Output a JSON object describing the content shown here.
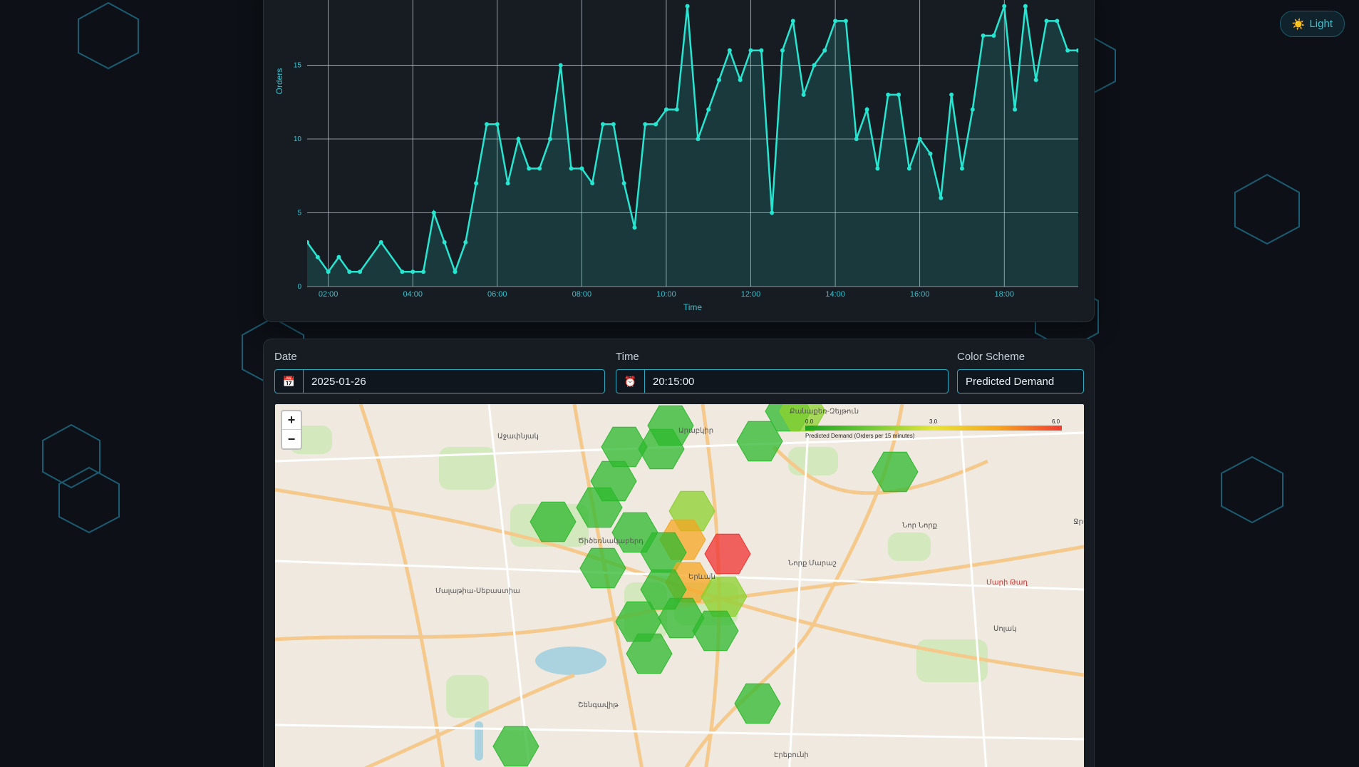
{
  "theme_toggle": {
    "icon": "☀️",
    "label": "Light"
  },
  "chart_data": {
    "type": "area",
    "xlabel": "Time",
    "ylabel": "Orders",
    "yticks": [
      0,
      5,
      10,
      15
    ],
    "xticks": [
      "02:00",
      "04:00",
      "06:00",
      "08:00",
      "10:00",
      "12:00",
      "14:00",
      "16:00",
      "18:00"
    ],
    "ylim": [
      0,
      18.5
    ],
    "xlim_hours": [
      1.5,
      19.75
    ],
    "x_hours": [
      1.5,
      1.75,
      2.0,
      2.25,
      2.5,
      2.75,
      3.25,
      3.75,
      4.0,
      4.25,
      4.5,
      4.75,
      5.0,
      5.25,
      5.5,
      5.75,
      6.0,
      6.25,
      6.5,
      6.75,
      7.0,
      7.25,
      7.5,
      7.75,
      8.0,
      8.25,
      8.5,
      8.75,
      9.0,
      9.25,
      9.5,
      9.75,
      10.0,
      10.25,
      10.5,
      10.75,
      11.0,
      11.25,
      11.5,
      11.75,
      12.0,
      12.25,
      12.5,
      12.75,
      13.0,
      13.25,
      13.5,
      13.75,
      14.0,
      14.25,
      14.5,
      14.75,
      15.0,
      15.25,
      15.5,
      15.75,
      16.0,
      16.25,
      16.5,
      16.75,
      17.0,
      17.25,
      17.5,
      17.75,
      18.0,
      18.25,
      18.5,
      18.75,
      19.0,
      19.25,
      19.5,
      19.75
    ],
    "values": [
      3,
      2,
      1,
      2,
      1,
      1,
      3,
      1,
      1,
      1,
      5,
      3,
      1,
      3,
      7,
      11,
      11,
      7,
      10,
      8,
      8,
      10,
      15,
      8,
      8,
      7,
      11,
      11,
      7,
      4,
      11,
      11,
      12,
      12,
      19,
      10,
      12,
      14,
      16,
      14,
      16,
      16,
      5,
      16,
      18,
      13,
      15,
      16,
      18,
      18,
      10,
      12,
      8,
      13,
      13,
      8,
      10,
      9,
      6,
      13,
      8,
      12,
      17,
      17,
      19,
      12,
      19,
      14,
      18,
      18,
      16,
      16
    ]
  },
  "controls": {
    "date_label": "Date",
    "date_value": "2025-01-26",
    "date_icon": "📅",
    "time_label": "Time",
    "time_value": "20:15:00",
    "time_icon": "⏰",
    "scheme_label": "Color Scheme",
    "scheme_value": "Predicted Demand"
  },
  "map": {
    "zoom_in": "+",
    "zoom_out": "−",
    "legend": {
      "min": "0.0",
      "mid": "3.0",
      "max": "6.0",
      "caption": "Predicted Demand (Orders per 15 minutes)"
    },
    "labels": [
      {
        "text": "Աջափնյակ"
      },
      {
        "text": "Արաբկիր"
      },
      {
        "text": "Քանաքեռ-Զեյթուն"
      },
      {
        "text": "Նոր Նորք"
      },
      {
        "text": "Նորք Մարաշ"
      },
      {
        "text": "Երևան"
      },
      {
        "text": "Մալաթիա-Սեբաստիա"
      },
      {
        "text": "Շենգավիթ"
      },
      {
        "text": "Էրեբունի"
      },
      {
        "text": "Ծիծեռնակաբերդ"
      },
      {
        "text": "Ջրվեժ"
      },
      {
        "text": "Մարի Թաղ"
      },
      {
        "text": "Սոլակ"
      }
    ],
    "hexes": [
      {
        "level": 0.5
      },
      {
        "level": 0.5
      },
      {
        "level": 0.5
      },
      {
        "level": 0.5
      },
      {
        "level": 0.5
      },
      {
        "level": 0.4
      },
      {
        "level": 0.5
      },
      {
        "level": 0.5
      },
      {
        "level": 0.5
      },
      {
        "level": 1.8
      },
      {
        "level": 3.8
      },
      {
        "level": 6.0
      },
      {
        "level": 0.6
      },
      {
        "level": 3.9
      },
      {
        "level": 2.4
      },
      {
        "level": 0.5
      },
      {
        "level": 0.5
      },
      {
        "level": 0.7
      },
      {
        "level": 0.5
      },
      {
        "level": 0.9
      },
      {
        "level": 0.5
      },
      {
        "level": 0.5
      },
      {
        "level": 0.5
      },
      {
        "level": 0.5
      },
      {
        "level": 1.0
      }
    ]
  }
}
